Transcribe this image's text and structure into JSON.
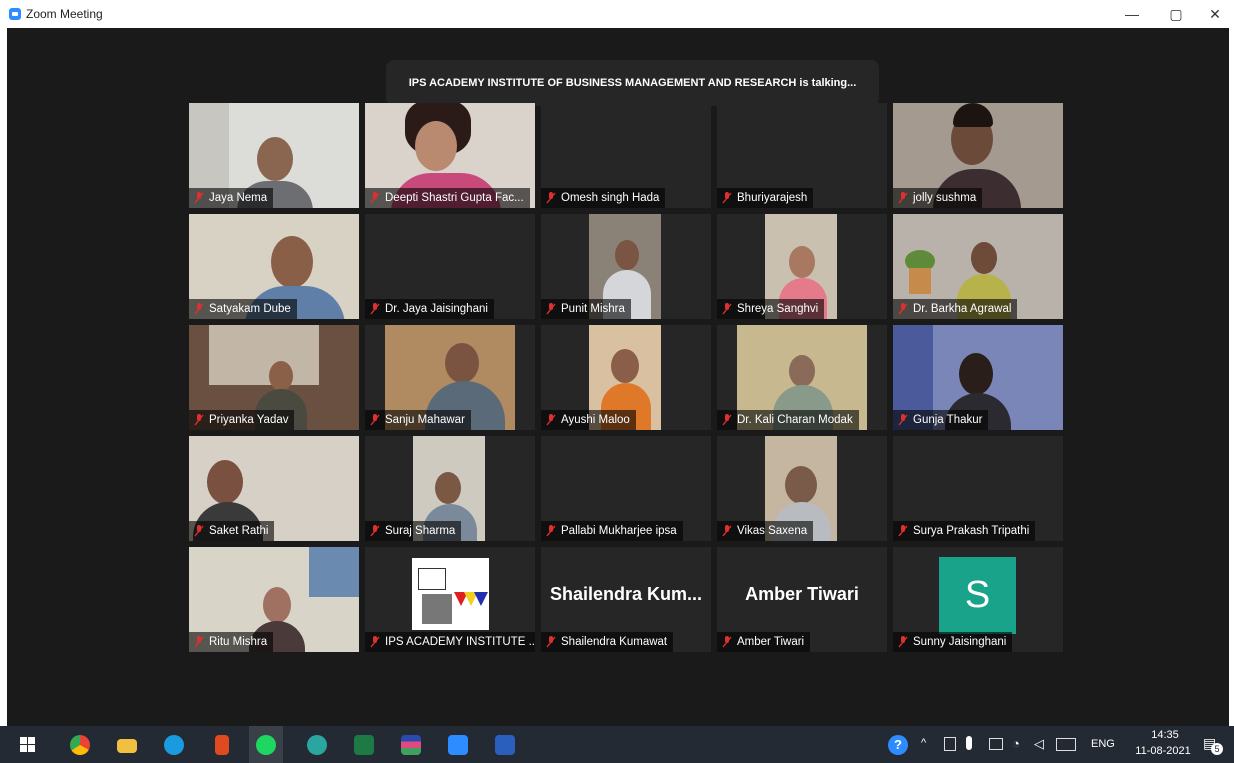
{
  "window": {
    "title": "Zoom Meeting",
    "minimize": "—",
    "restore": "▢",
    "close": "✕"
  },
  "speaker_banner": "IPS ACADEMY INSTITUTE OF BUSINESS MANAGEMENT AND RESEARCH is talking...",
  "participants": [
    {
      "name": "Jaya Nema"
    },
    {
      "name": "Deepti Shastri Gupta Fac..."
    },
    {
      "name": "Omesh singh Hada"
    },
    {
      "name": "Bhuriyarajesh"
    },
    {
      "name": "jolly sushma"
    },
    {
      "name": "Satyakam Dube"
    },
    {
      "name": "Dr. Jaya Jaisinghani"
    },
    {
      "name": "Punit Mishra"
    },
    {
      "name": "Shreya Sanghvi"
    },
    {
      "name": "Dr. Barkha Agrawal"
    },
    {
      "name": "Priyanka Yadav"
    },
    {
      "name": "Sanju Mahawar"
    },
    {
      "name": "Ayushi Maloo"
    },
    {
      "name": "Dr. Kali Charan Modak"
    },
    {
      "name": "Gunja Thakur"
    },
    {
      "name": "Saket Rathi"
    },
    {
      "name": "Suraj Sharma"
    },
    {
      "name": "Pallabi Mukharjee ipsa"
    },
    {
      "name": "Vikas Saxena"
    },
    {
      "name": "Surya Prakash Tripathi"
    },
    {
      "name": "Ritu Mishra"
    },
    {
      "name": "IPS ACADEMY INSTITUTE ..."
    },
    {
      "name": "Shailendra Kumawat",
      "display": "Shailendra Kum..."
    },
    {
      "name": "Amber Tiwari",
      "display": "Amber Tiwari"
    },
    {
      "name": "Sunny Jaisinghani",
      "avatar_letter": "S",
      "avatar_color": "#1aa38b"
    }
  ],
  "taskbar": {
    "language": "ENG",
    "time": "14:35",
    "date": "11-08-2021",
    "notification_count": "5"
  },
  "colors": {
    "muted_mic": "#e02f2f",
    "zoom_blue": "#2d8cff"
  }
}
